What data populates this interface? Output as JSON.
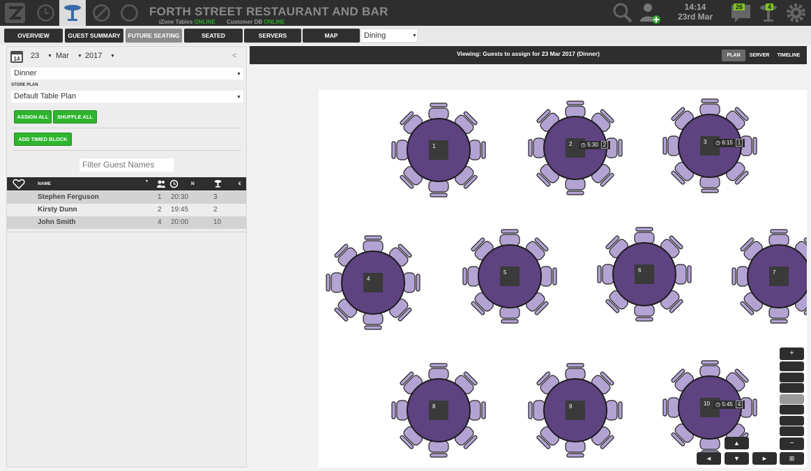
{
  "header": {
    "title": "FORTH STREET RESTAURANT AND BAR",
    "izone_label": "iZone Tables",
    "izone_status": "ONLINE",
    "customer_label": "Customer DB",
    "customer_status": "ONLINE",
    "time": "14:14",
    "date": "23rd Mar",
    "messages_badge": "26",
    "tables_badge": "4"
  },
  "icons": {
    "logo": "z-logo-icon",
    "clock": "clock-icon",
    "table": "table-icon",
    "no_table": "no-table-icon",
    "circle": "circle-icon",
    "search": "search-icon",
    "add_user": "add-user-icon",
    "messages": "chat-icon",
    "tables": "table-icon",
    "settings": "gear-icon"
  },
  "nav": {
    "tabs": [
      {
        "label": "OVERVIEW"
      },
      {
        "label": "GUEST SUMMARY"
      },
      {
        "label": "FUTURE SEATING"
      },
      {
        "label": "SEATED"
      },
      {
        "label": "SERVERS"
      },
      {
        "label": "MAP"
      }
    ],
    "active": "FUTURE SEATING",
    "area_select": "Dining"
  },
  "panel": {
    "day": "23",
    "month": "Mar",
    "year": "2017",
    "collapse": "<",
    "calendar_day": "14",
    "session": "Dinner",
    "store_plan_label": "STORE PLAN",
    "store_plan": "Default Table Plan",
    "assign_all": "ASSIGN ALL",
    "shuffle_all": "SHUFFLE ALL",
    "add_timed_block": "ADD TIMED BLOCK",
    "filter_placeholder": "Filter Guest Names",
    "table": {
      "headers": {
        "name": "NAME",
        "n": "N",
        "currency": "€"
      },
      "rows": [
        {
          "name": "Stephen Ferguson",
          "covers": "1",
          "time": "20:30",
          "table": "3"
        },
        {
          "name": "Kirsty Dunn",
          "covers": "2",
          "time": "19:45",
          "table": "2"
        },
        {
          "name": "John Smith",
          "covers": "4",
          "time": "20:00",
          "table": "10"
        }
      ]
    }
  },
  "view": {
    "title": "Viewing: Guests to assign for 23 Mar 2017 (Dinner)",
    "modes": [
      "PLAN",
      "SERVER",
      "TIMELINE"
    ],
    "active_mode": "PLAN"
  },
  "floor": {
    "tables": [
      {
        "id": "1",
        "booking_time": "",
        "covers": ""
      },
      {
        "id": "2",
        "booking_time": "5:30",
        "covers": "2"
      },
      {
        "id": "3",
        "booking_time": "6:15",
        "covers": "1"
      },
      {
        "id": "4",
        "booking_time": "",
        "covers": ""
      },
      {
        "id": "5",
        "booking_time": "",
        "covers": ""
      },
      {
        "id": "6",
        "booking_time": "",
        "covers": ""
      },
      {
        "id": "7",
        "booking_time": "",
        "covers": ""
      },
      {
        "id": "8",
        "booking_time": "",
        "covers": ""
      },
      {
        "id": "9",
        "booking_time": "",
        "covers": ""
      },
      {
        "id": "10",
        "booking_time": "5:45",
        "covers": "4"
      }
    ]
  },
  "controls": {
    "zoom_in": "+",
    "zoom_out": "−",
    "up": "▲",
    "down": "▼",
    "left": "◄",
    "right": "►",
    "fit": "⊞"
  },
  "colors": {
    "table": "#5e4381",
    "chair": "#b3a3d3",
    "ok": "#2da42d",
    "badge": "#7cc81c",
    "button": "#2db52d"
  }
}
